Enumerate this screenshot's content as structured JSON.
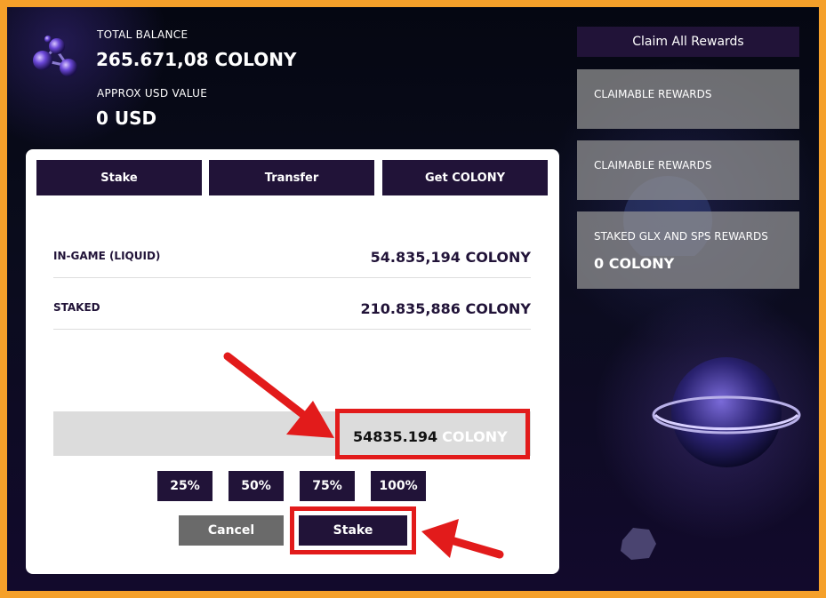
{
  "balance": {
    "total_label": "TOTAL BALANCE",
    "total_value": "265.671,08 COLONY",
    "usd_label": "APPROX USD VALUE",
    "usd_value": "0 USD"
  },
  "tabs": [
    {
      "label": "Stake"
    },
    {
      "label": "Transfer"
    },
    {
      "label": "Get COLONY"
    }
  ],
  "rows": [
    {
      "label": "IN-GAME (LIQUID)",
      "value": "54.835,194 COLONY"
    },
    {
      "label": "STAKED",
      "value": "210.835,886 COLONY"
    }
  ],
  "amount": {
    "value": "54835.194",
    "unit": "COLONY"
  },
  "percent_buttons": [
    "25%",
    "50%",
    "75%",
    "100%"
  ],
  "actions": {
    "cancel_label": "Cancel",
    "stake_label": "Stake"
  },
  "sidebar": {
    "claim_all_label": "Claim All Rewards",
    "cards": [
      {
        "label": "CLAIMABLE REWARDS",
        "value": ""
      },
      {
        "label": "CLAIMABLE REWARDS",
        "value": ""
      },
      {
        "label": "STAKED GLX AND SPS REWARDS",
        "value": "0 COLONY"
      }
    ]
  },
  "colors": {
    "brand_dark": "#211338",
    "highlight_red": "#e21b1b",
    "frame_orange": "#f5a02a"
  },
  "icons": [
    "planet-logo-icon",
    "arrow-icon"
  ]
}
